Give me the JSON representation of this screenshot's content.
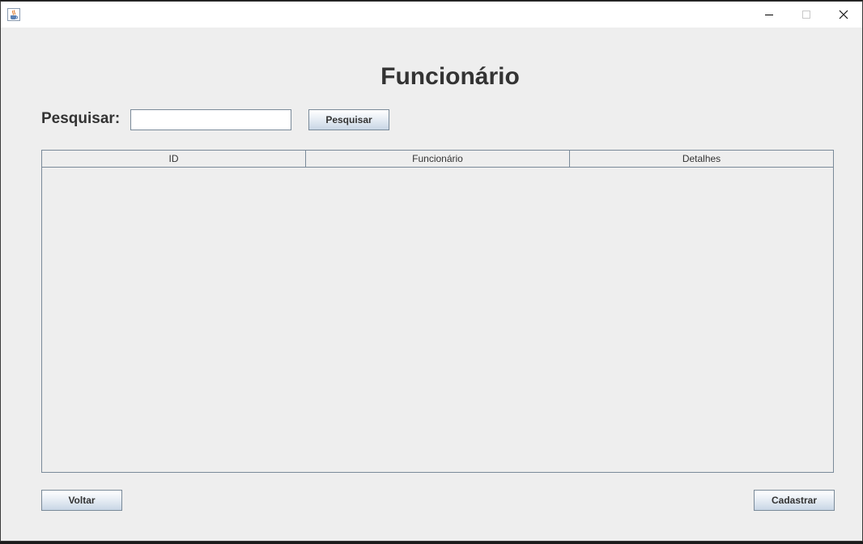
{
  "window": {
    "app_icon": "java-cup-icon",
    "controls": [
      "minimize-icon",
      "maximize-icon",
      "close-icon"
    ]
  },
  "main": {
    "title": "Funcionário",
    "search_label": "Pesquisar:",
    "search_value": "",
    "search_button": "Pesquisar"
  },
  "table": {
    "columns": [
      "ID",
      "Funcionário",
      "Detalhes"
    ],
    "rows": []
  },
  "footer": {
    "back_button": "Voltar",
    "register_button": "Cadastrar"
  }
}
